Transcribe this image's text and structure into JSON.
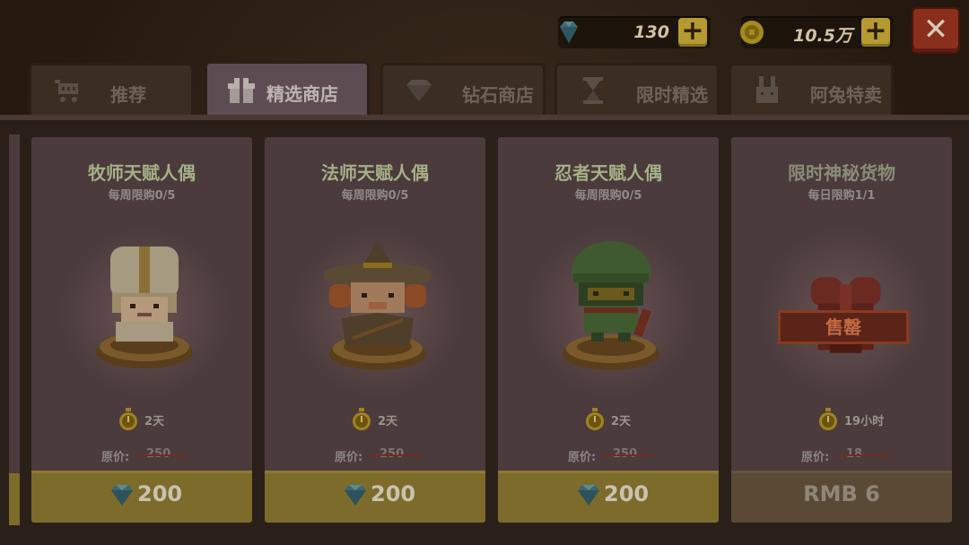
{
  "resources": {
    "diamonds": {
      "value": "130",
      "icon": "diamond-icon"
    },
    "gold": {
      "value": "10.5万",
      "icon": "gold-coin-icon"
    },
    "plus_label": "+",
    "close_label": "✕"
  },
  "tabs": [
    {
      "label": "推荐",
      "icon": "cart-icon",
      "active": false
    },
    {
      "label": "精选商店",
      "icon": "gift-icon",
      "active": true
    },
    {
      "label": "钻石商店",
      "icon": "diamond-icon",
      "active": false
    },
    {
      "label": "限时精选",
      "icon": "hourglass-icon",
      "active": false
    },
    {
      "label": "阿兔特卖",
      "icon": "bunny-icon",
      "active": false
    }
  ],
  "cards": [
    {
      "title": "牧师天赋人偶",
      "limit": "每周限购0/5",
      "timer": "2天",
      "orig_label": "原价:",
      "orig_value": "250",
      "price": "200",
      "currency_icon": "diamond-icon",
      "figure": "priest-doll"
    },
    {
      "title": "法师天赋人偶",
      "limit": "每周限购0/5",
      "timer": "2天",
      "orig_label": "原价:",
      "orig_value": "250",
      "price": "200",
      "currency_icon": "diamond-icon",
      "figure": "wizard-doll"
    },
    {
      "title": "忍者天赋人偶",
      "limit": "每周限购0/5",
      "timer": "2天",
      "orig_label": "原价:",
      "orig_value": "250",
      "price": "200",
      "currency_icon": "diamond-icon",
      "figure": "ninja-doll"
    },
    {
      "title": "限时神秘货物",
      "limit": "每日限购1/1",
      "timer": "19小时",
      "orig_label": "原价:",
      "orig_value": "18",
      "price": "RMB 6",
      "sold_label": "售罄",
      "figure": "gift-box"
    }
  ],
  "colors": {
    "accent_gold": "#7d6b2b",
    "close_red": "#8a2f1c",
    "title_green": "#a5b087"
  }
}
